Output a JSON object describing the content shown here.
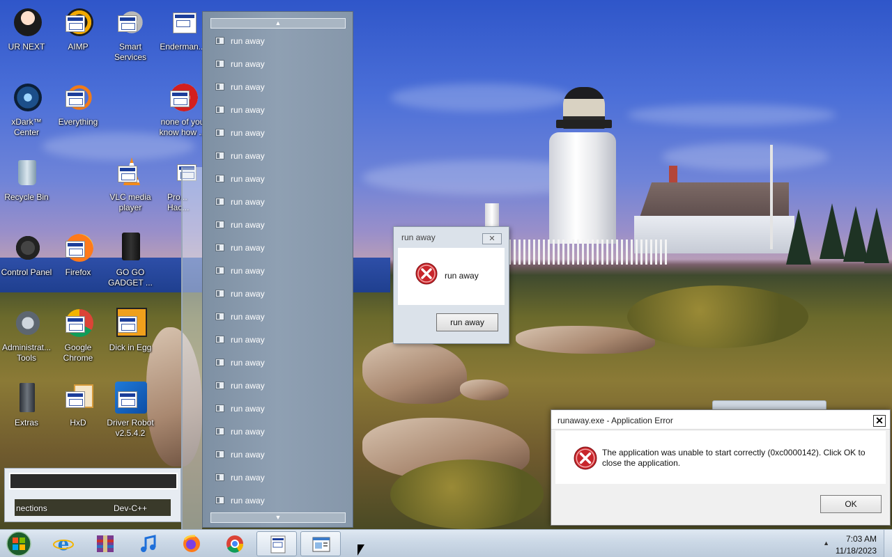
{
  "desktop": {
    "icons": [
      {
        "label": "UR NEXT",
        "icon": "anime-character-icon"
      },
      {
        "label": "AIMP",
        "icon": "aimp-icon"
      },
      {
        "label": "Smart Services",
        "icon": "gears-icon"
      },
      {
        "label": "Enderman...",
        "icon": "app-window-icon"
      },
      {
        "label": "xDark™ Center",
        "icon": "xdark-icon"
      },
      {
        "label": "Everything",
        "icon": "everything-search-icon"
      },
      {
        "label": "none of you know how ...",
        "icon": "red-swirl-icon"
      },
      {
        "label": "Recycle Bin",
        "icon": "recycle-bin-icon"
      },
      {
        "label": "VLC media player",
        "icon": "vlc-cone-icon"
      },
      {
        "label": "Pro... Hac...",
        "icon": "app-window-icon"
      },
      {
        "label": "Control Panel",
        "icon": "control-panel-icon"
      },
      {
        "label": "Firefox",
        "icon": "firefox-icon"
      },
      {
        "label": "GO GO GADGET ...",
        "icon": "gadget-icon"
      },
      {
        "label": "Administrat... Tools",
        "icon": "admin-tools-icon"
      },
      {
        "label": "Google Chrome",
        "icon": "chrome-icon"
      },
      {
        "label": "Dick in Egg",
        "icon": "dick-in-egg-icon"
      },
      {
        "label": "Extras",
        "icon": "extras-icon"
      },
      {
        "label": "HxD",
        "icon": "hxd-icon"
      },
      {
        "label": "Driver Robot v2.5.4.2",
        "icon": "driver-robot-icon"
      }
    ],
    "ghost_window_texts": [
      "nections",
      "Dev-C++"
    ]
  },
  "list_panel": {
    "scroll_up": "▲",
    "scroll_down": "▼",
    "items": [
      "run away",
      "run away",
      "run away",
      "run away",
      "run away",
      "run away",
      "run away",
      "run away",
      "run away",
      "run away",
      "run away",
      "run away",
      "run away",
      "run away",
      "run away",
      "run away",
      "run away",
      "run away",
      "run away",
      "run away",
      "run away"
    ]
  },
  "small_dialog": {
    "title": "run away",
    "close": "✕",
    "message": "run away",
    "button": "run away"
  },
  "error_dialog": {
    "title": "runaway.exe - Application Error",
    "close": "✕",
    "message": "The application was unable to start correctly (0xc0000142). Click OK to close the application.",
    "button": "OK"
  },
  "taskbar": {
    "buttons": [
      {
        "name": "internet-explorer-icon"
      },
      {
        "name": "winrar-icon"
      },
      {
        "name": "itunes-icon"
      },
      {
        "name": "firefox-icon"
      },
      {
        "name": "chrome-icon"
      },
      {
        "name": "runaway-app-icon"
      },
      {
        "name": "window-app-icon"
      }
    ],
    "tray_arrow": "▲",
    "time": "7:03 AM",
    "date": "11/18/2023"
  },
  "colors": {
    "error_red": "#c8262b",
    "taskbar": "#cbd8e6",
    "list_panel": "#8a9bae"
  }
}
